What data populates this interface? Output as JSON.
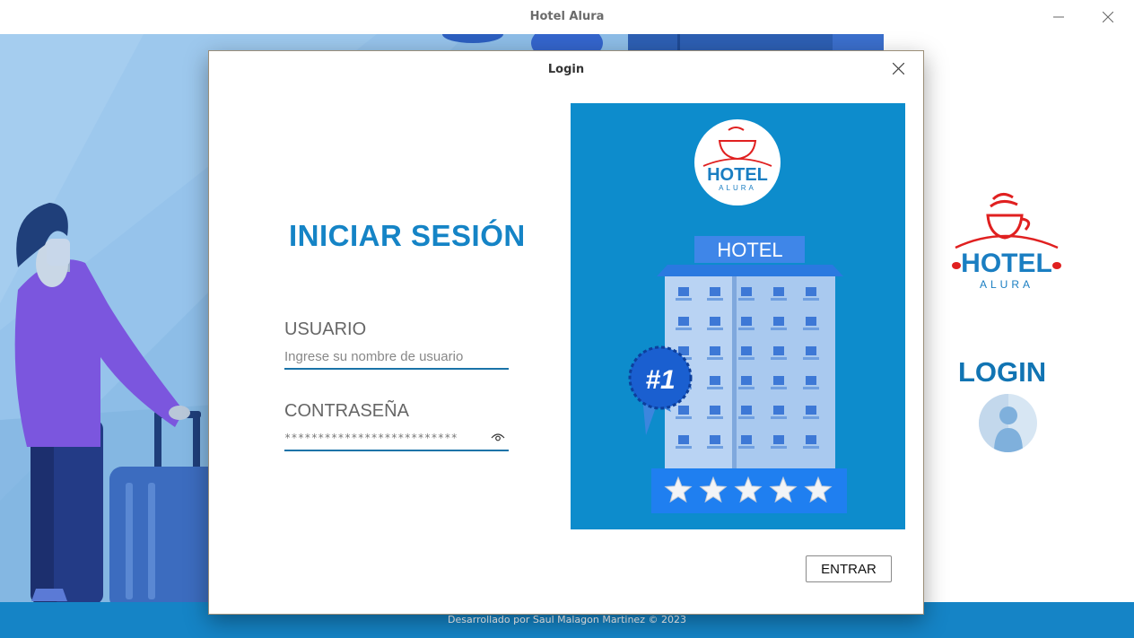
{
  "window": {
    "title": "Hotel Alura",
    "minimize_icon": "minimize-icon",
    "close_icon": "close-icon"
  },
  "main_screen": {
    "logo": {
      "line1": "HOTEL",
      "line2": "ALURA"
    },
    "login_label": "LOGIN",
    "footer_text": "Desarrollado por Saul Malagon Martinez © 2023"
  },
  "dialog": {
    "title": "Login",
    "heading": "INICIAR SESIÓN",
    "username": {
      "label": "USUARIO",
      "placeholder": "Ingrese su nombre de usuario",
      "value": ""
    },
    "password": {
      "label": "CONTRASEÑA",
      "masked_value": "**************************"
    },
    "illustration": {
      "logo_line1": "HOTEL",
      "logo_line2": "ALURA",
      "sign": "HOTEL",
      "badge": "#1",
      "stars": 5
    },
    "submit_label": "ENTRAR"
  },
  "colors": {
    "accent": "#1584C6",
    "heading": "#1584C6",
    "footer": "#1584C6",
    "illustration_bg": "#0D8CCC",
    "logo_red": "#E02020"
  }
}
